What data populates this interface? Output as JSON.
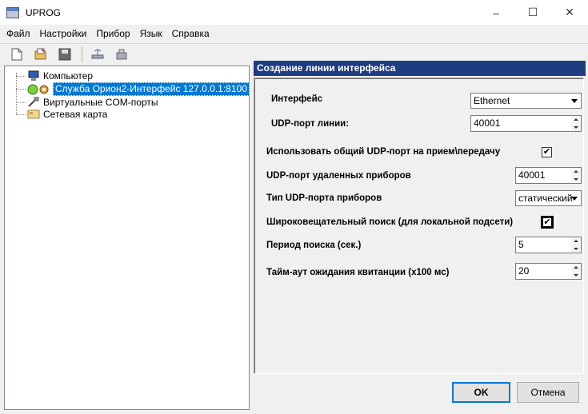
{
  "window": {
    "title": "UPROG",
    "minimize_glyph": "–",
    "maximize_glyph": "☐",
    "close_glyph": "✕"
  },
  "menu": [
    "Файл",
    "Настройки",
    "Прибор",
    "Язык",
    "Справка"
  ],
  "toolbar": {
    "icons": [
      "new-document-icon",
      "open-icon",
      "save-icon",
      "network-icon",
      "device-icon"
    ]
  },
  "tree": {
    "items": [
      {
        "label": "Компьютер",
        "icon": "computer-icon"
      },
      {
        "label": "Служба Орион2-Интерфейс 127.0.0.1:8100",
        "icon": "service-icon",
        "selected": true
      },
      {
        "label": "Виртуальные COM-порты",
        "icon": "plug-icon"
      },
      {
        "label": "Сетевая карта",
        "icon": "network-card-icon"
      }
    ]
  },
  "panel": {
    "header": "Создание линии интерфейса",
    "interface_label": "Интерфейс",
    "interface_value": "Ethernet",
    "udp_port_label": "UDP-порт линии:",
    "udp_port_value": "40001",
    "shared_port_label": "Использовать общий UDP-порт на прием\\передачу",
    "shared_port_checked": true,
    "remote_port_label": "UDP-порт удаленных приборов",
    "remote_port_value": "40001",
    "port_type_label": "Тип UDP-порта приборов",
    "port_type_value": "статический",
    "broadcast_label": "Широковещательный поиск (для локальной подсети)",
    "broadcast_checked": true,
    "search_period_label": "Период поиска (сек.)",
    "search_period_value": "5",
    "timeout_label": "Тайм-аут ожидания квитанции (х100 мс)",
    "timeout_value": "20"
  },
  "buttons": {
    "ok": "OK",
    "cancel": "Отмена"
  },
  "colors": {
    "header_bg": "#1e3c82",
    "selection": "#0078d7"
  }
}
